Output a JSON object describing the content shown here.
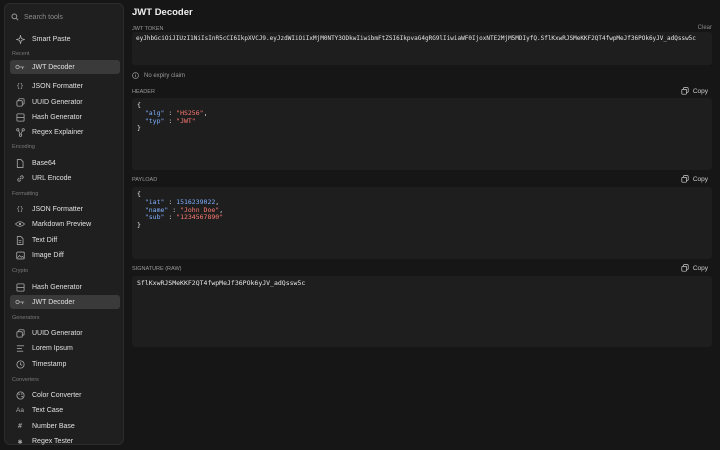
{
  "sidebar": {
    "search_placeholder": "Search tools",
    "smart_paste": "Smart Paste",
    "sections": [
      {
        "label": "Recent",
        "items": [
          "JWT Decoder",
          "JSON Formatter",
          "UUID Generator",
          "Hash Generator",
          "Regex Explainer"
        ]
      },
      {
        "label": "Encoding",
        "items": [
          "Base64",
          "URL Encode"
        ]
      },
      {
        "label": "Formatting",
        "items": [
          "JSON Formatter",
          "Markdown Preview",
          "Text Diff",
          "Image Diff"
        ]
      },
      {
        "label": "Crypto",
        "items": [
          "Hash Generator",
          "JWT Decoder"
        ]
      },
      {
        "label": "Generators",
        "items": [
          "UUID Generator",
          "Lorem Ipsum",
          "Timestamp"
        ]
      },
      {
        "label": "Converters",
        "items": [
          "Color Converter",
          "Text Case",
          "Number Base",
          "Regex Tester"
        ]
      }
    ]
  },
  "main": {
    "title": "JWT Decoder",
    "token_label": "JWT TOKEN",
    "clear_label": "Clear",
    "token_value": "eyJhbGciOiJIUzI1NiIsInR5cCI6IkpXVCJ9.eyJzdWIiOiIxMjM0NTY3ODkwIiwibmFtZSI6IkpvaG4gRG9lIiwiaWF0IjoxNTE2MjM5MDIyfQ.SflKxwRJSMeKKF2QT4fwpMeJf36POk6yJV_adQssw5c",
    "expiry_text": "No expiry claim",
    "copy_label": "Copy",
    "header": {
      "label": "HEADER",
      "alg_key": "\"alg\"",
      "alg_val": "\"HS256\"",
      "typ_key": "\"typ\"",
      "typ_val": "\"JWT\""
    },
    "payload": {
      "label": "PAYLOAD",
      "iat_key": "\"iat\"",
      "iat_val": "1516239022",
      "name_key": "\"name\"",
      "name_val": "\"John Doe\"",
      "sub_key": "\"sub\"",
      "sub_val": "\"1234567890\""
    },
    "signature": {
      "label": "SIGNATURE (RAW)",
      "value": "SflKxwRJSMeKKF2QT4fwpMeJf36POk6yJV_adQssw5c"
    }
  }
}
